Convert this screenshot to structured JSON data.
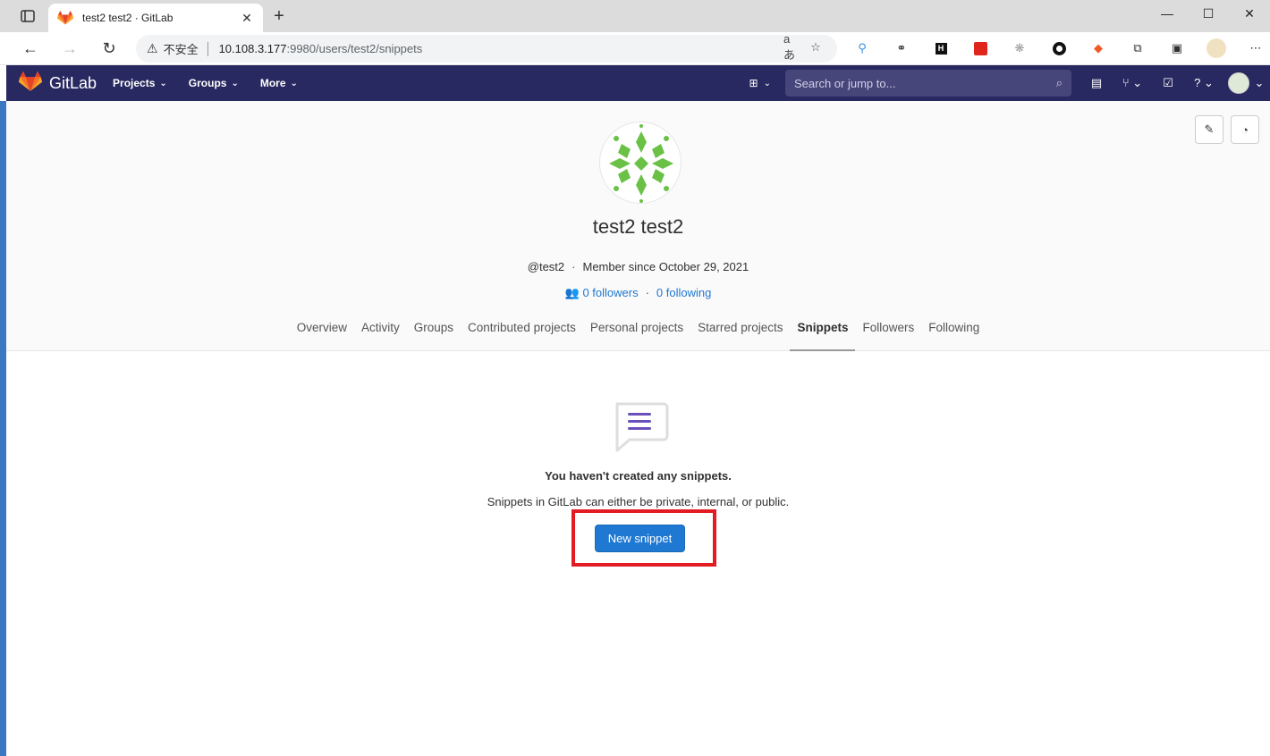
{
  "browser": {
    "tab_title": "test2 test2 · GitLab",
    "insecure_label": "不安全",
    "url_host": "10.108.3.177",
    "url_path": ":9980/users/test2/snippets"
  },
  "gitlab_header": {
    "brand": "GitLab",
    "menu": [
      "Projects",
      "Groups",
      "More"
    ],
    "search_placeholder": "Search or jump to..."
  },
  "profile": {
    "name": "test2 test2",
    "username": "@test2",
    "member_since": "Member since October 29, 2021",
    "followers": "0 followers",
    "following": "0 following",
    "tabs": [
      "Overview",
      "Activity",
      "Groups",
      "Contributed projects",
      "Personal projects",
      "Starred projects",
      "Snippets",
      "Followers",
      "Following"
    ],
    "active_tab": "Snippets"
  },
  "empty_state": {
    "title": "You haven't created any snippets.",
    "description": "Snippets in GitLab can either be private, internal, or public.",
    "button_label": "New snippet"
  },
  "colors": {
    "header_bg": "#292961",
    "primary": "#1f78d1",
    "highlight": "#e31b23"
  }
}
